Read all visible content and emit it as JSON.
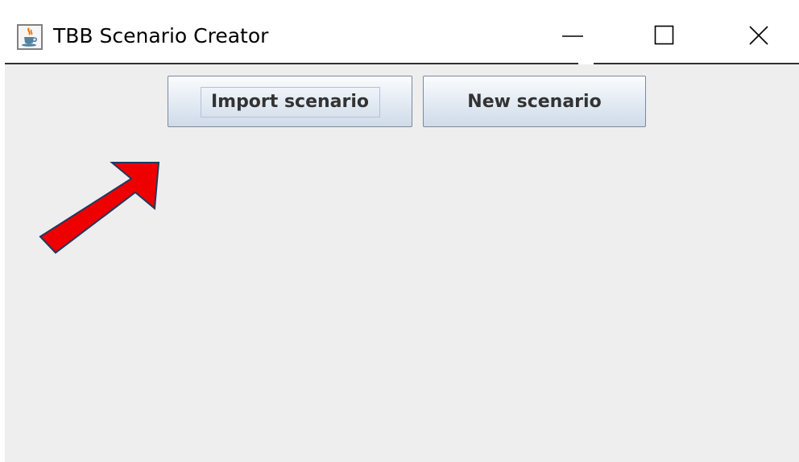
{
  "window": {
    "title": "TBB Scenario Creator",
    "app_icon": "java-cup-icon",
    "caption_buttons": [
      "minimize-icon",
      "maximize-icon",
      "close-icon"
    ]
  },
  "toolbar": {
    "import_label": "Import scenario",
    "new_label": "New scenario"
  },
  "annotation": {
    "icon": "red-arrow-icon",
    "color": "#ee0000",
    "points_to": "Import scenario"
  },
  "colors": {
    "content_bg": "#eeeeee",
    "button_text": "#333333"
  }
}
